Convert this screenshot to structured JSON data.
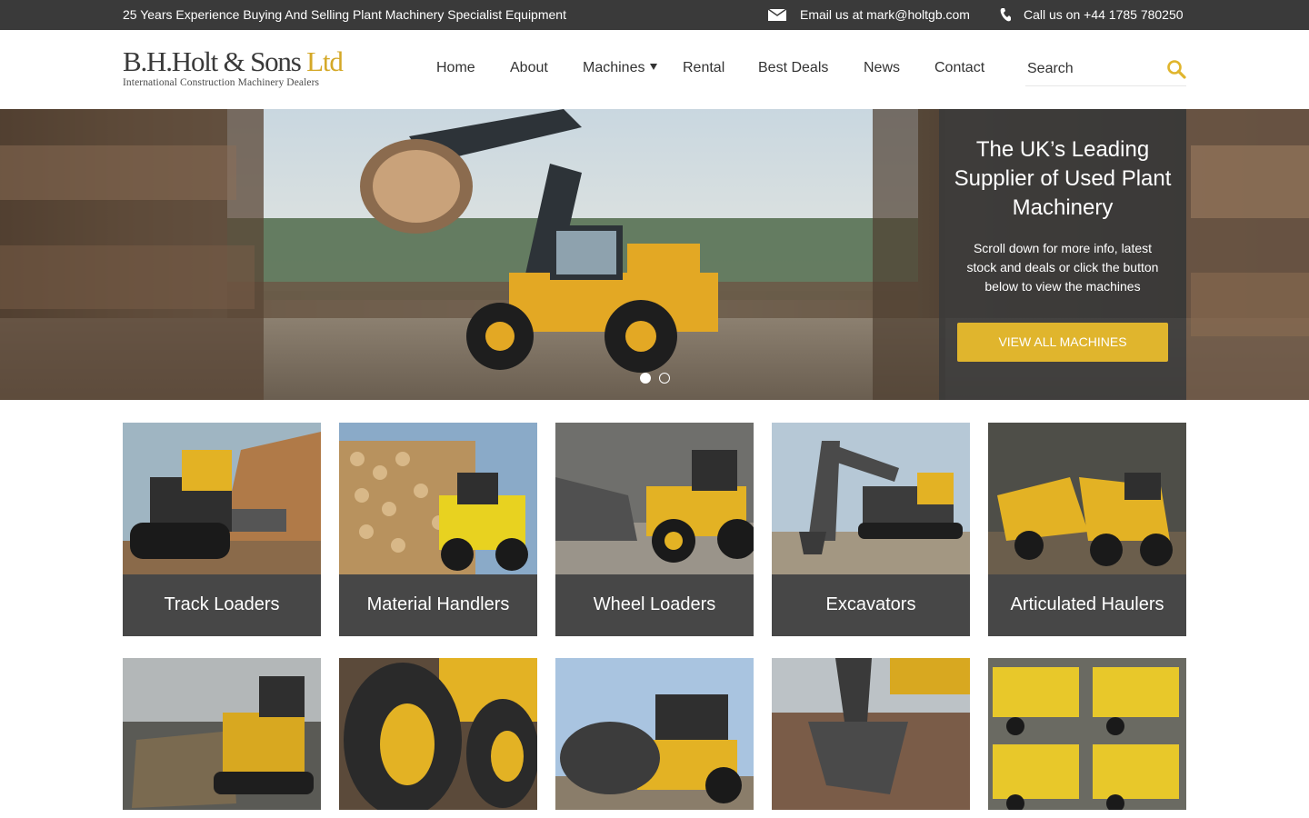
{
  "topbar": {
    "tagline": "25 Years Experience Buying And Selling Plant Machinery Specialist Equipment",
    "email_text": "Email us at mark@holtgb.com",
    "phone_text": "Call us on +44 1785 780250",
    "email_icon": "envelope-icon",
    "phone_icon": "phone-icon"
  },
  "logo": {
    "name_main": "B.H.Holt & Sons",
    "name_suffix": "Ltd",
    "subtitle": "International Construction Machinery Dealers"
  },
  "nav": {
    "items": [
      {
        "label": "Home"
      },
      {
        "label": "About"
      },
      {
        "label": "Machines",
        "has_dropdown": true
      },
      {
        "label": "Rental"
      },
      {
        "label": "Best Deals"
      },
      {
        "label": "News"
      },
      {
        "label": "Contact"
      }
    ]
  },
  "search": {
    "placeholder": "Search",
    "icon": "search-icon"
  },
  "hero": {
    "title": "The UK’s Leading Supplier of Used Plant Machinery",
    "text": "Scroll down for more info, latest stock and deals or click the button below to view the machines",
    "button_label": "VIEW ALL MACHINES",
    "slides_total": 2,
    "active_slide": 1
  },
  "categories": {
    "row1": [
      {
        "label": "Track Loaders"
      },
      {
        "label": "Material Handlers"
      },
      {
        "label": "Wheel Loaders"
      },
      {
        "label": "Excavators"
      },
      {
        "label": "Articulated Haulers"
      }
    ],
    "row2_count": 5
  },
  "colors": {
    "accent": "#e0b52d",
    "dark": "#3a3a3a",
    "card_label_bg": "#474747"
  }
}
